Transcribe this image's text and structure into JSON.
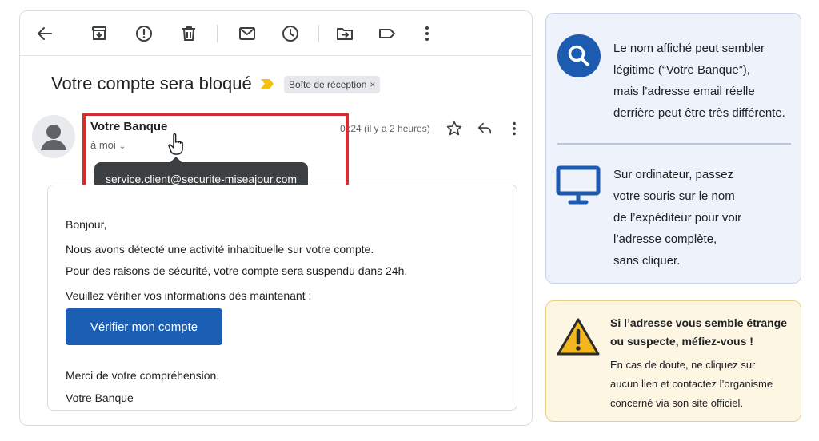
{
  "toolbar": {
    "icons": [
      "back-arrow-icon",
      "archive-icon",
      "report-spam-icon",
      "delete-icon",
      "mark-unread-icon",
      "snooze-icon",
      "move-to-icon",
      "label-icon",
      "more-vert-icon"
    ]
  },
  "email": {
    "subject": "Votre compte sera bloqué",
    "label_chip": "Boîte de réception",
    "label_chip_close": "×",
    "sender_name": "Votre Banque",
    "recipient": "à moi",
    "tooltip_email": "service.client@securite-miseajour.com",
    "timestamp": "0 :24 (il y a 2 heures)",
    "body": {
      "greeting": "Bonjour,",
      "line1": "Nous avons détecté une activité inhabituelle sur votre compte.",
      "line2": "Pour des raisons de sécurité, votre compte sera suspendu dans 24h.",
      "line3": "Veuillez vérifier vos informations dès maintenant :",
      "button_label": "Vérifier mon compte",
      "thanks": "Merci de votre compréhension.",
      "signature": "Votre Banque"
    }
  },
  "info_panel": {
    "tip1": [
      "Le nom affiché peut sembler",
      "légitime (“Votre Banque”),",
      "mais l’adresse email réelle",
      "derrière peut être très différente."
    ],
    "tip2": [
      "Sur ordinateur, passez",
      "votre souris sur le nom",
      "de l’expéditeur pour voir",
      "l’adresse complète,",
      "sans cliquer."
    ]
  },
  "warning_panel": {
    "title": [
      "Si l’adresse vous semble étrange",
      "ou suspecte, méfiez-vous !"
    ],
    "text": [
      "En cas de doute, ne cliquez sur",
      "aucun lien et contactez l’organisme",
      "concerné via son site officiel."
    ]
  },
  "colors": {
    "alert_red": "#d32f2f",
    "primary_blue": "#1a5fb4",
    "info_bg": "#eef2fa",
    "warning_bg": "#fdf6e3",
    "warning_yellow": "#f2b71f"
  }
}
